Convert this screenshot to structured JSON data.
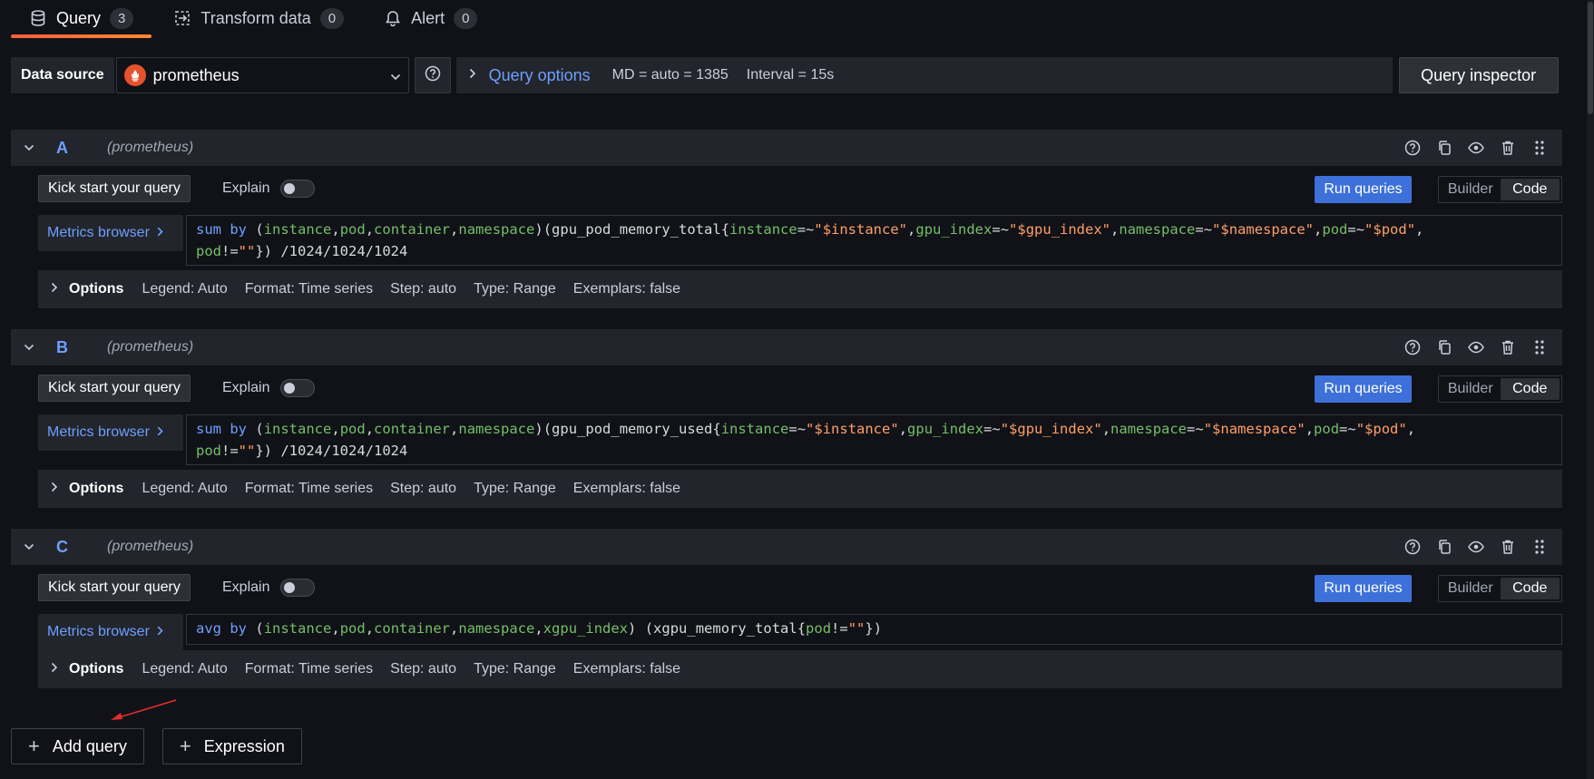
{
  "tabs": [
    {
      "label": "Query",
      "count": "3",
      "icon": "database-icon",
      "active": true
    },
    {
      "label": "Transform data",
      "count": "0",
      "icon": "transform-icon",
      "active": false
    },
    {
      "label": "Alert",
      "count": "0",
      "icon": "bell-icon",
      "active": false
    }
  ],
  "datasource": {
    "label": "Data source",
    "selected": "prometheus",
    "query_options_label": "Query options",
    "md": "MD = auto = 1385",
    "interval": "Interval = 15s",
    "inspector_label": "Query inspector"
  },
  "common": {
    "kick_label": "Kick start your query",
    "explain_label": "Explain",
    "run_label": "Run queries",
    "builder_label": "Builder",
    "code_label": "Code",
    "metrics_browser_label": "Metrics browser",
    "options_label": "Options"
  },
  "queries": [
    {
      "letter": "A",
      "datasource": "(prometheus)",
      "expr": "sum by (instance,pod,container,namespace)(gpu_pod_memory_total{instance=~\"$instance\",gpu_index=~\"$gpu_index\",namespace=~\"$namespace\",pod=~\"$pod\", pod!=\"\"}) /1024/1024/1024",
      "options": [
        "Legend: Auto",
        "Format: Time series",
        "Step: auto",
        "Type: Range",
        "Exemplars: false"
      ]
    },
    {
      "letter": "B",
      "datasource": "(prometheus)",
      "expr": "sum by (instance,pod,container,namespace)(gpu_pod_memory_used{instance=~\"$instance\",gpu_index=~\"$gpu_index\",namespace=~\"$namespace\",pod=~\"$pod\", pod!=\"\"}) /1024/1024/1024",
      "options": [
        "Legend: Auto",
        "Format: Time series",
        "Step: auto",
        "Type: Range",
        "Exemplars: false"
      ]
    },
    {
      "letter": "C",
      "datasource": "(prometheus)",
      "expr": "avg by (instance,pod,container,namespace,xgpu_index) (xgpu_memory_total{pod!=\"\"})",
      "options": [
        "Legend: Auto",
        "Format: Time series",
        "Step: auto",
        "Type: Range",
        "Exemplars: false"
      ]
    }
  ],
  "footer": {
    "add_query_label": "Add query",
    "expression_label": "Expression"
  },
  "colors": {
    "accent_blue": "#6e9fff",
    "run_button": "#3d71d9",
    "tab_underline": "#f55f3e",
    "prometheus_logo": "#e6522c",
    "annotation_arrow": "#e02f2f"
  }
}
